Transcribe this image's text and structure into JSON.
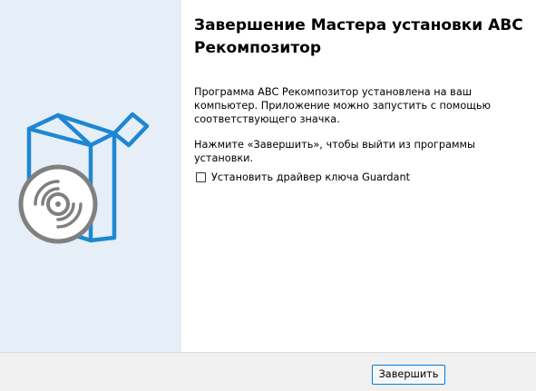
{
  "wizard": {
    "title": "Завершение Мастера установки ABC Рекомпозитор",
    "paragraph1": "Программа ABC Рекомпозитор установлена на ваш компьютер. Приложение можно запустить с помощью соответствующего значка.",
    "paragraph2": "Нажмите «Завершить», чтобы выйти из программы установки.",
    "checkbox": {
      "label": "Установить драйвер ключа Guardant",
      "checked": false
    }
  },
  "buttons": {
    "finish_label": "Завершить"
  },
  "side_panel": {
    "icon": "box-with-disc-icon"
  },
  "colors": {
    "side_panel_bg": "#e6eff7",
    "box_blue": "#1e87d2",
    "disc_gray": "#808080",
    "button_border": "#0078d7",
    "button_bar_bg": "#f0f0f0"
  }
}
